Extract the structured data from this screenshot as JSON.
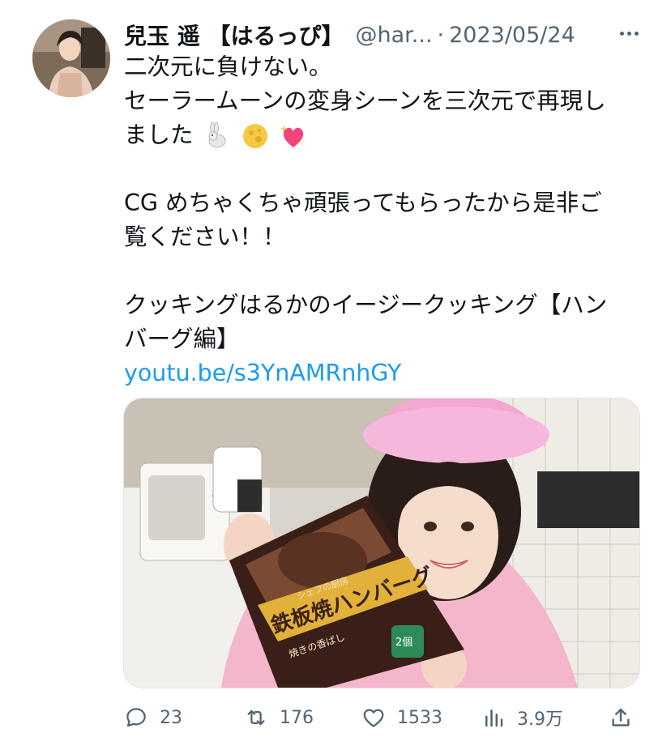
{
  "tweet": {
    "author_name": "兒玉 遥 【はるっぴ】",
    "handle": "@har...",
    "separator": "·",
    "date": "2023/05/24",
    "text_lines": [
      "二次元に負けない。",
      "セーラームーンの変身シーンを三次元で再現し",
      "ました",
      "",
      "CG めちゃくちゃ頑張ってもらったから是非ご",
      "覧ください！！",
      "",
      "クッキングはるかのイージークッキング【ハン",
      "バーグ編】"
    ],
    "link": "youtu.be/s3YnAMRnhGY",
    "emojis": [
      "rabbit-icon",
      "full-moon-icon",
      "sparkling-heart-icon"
    ]
  },
  "media": {
    "package_title": "鉄板焼ハンバーグ",
    "package_subtitle": "シェフの厨房",
    "package_tagline": "焼きの香ばし",
    "package_count": "2個"
  },
  "actions": {
    "replies": "23",
    "retweets": "176",
    "likes": "1533",
    "views": "3.9万"
  },
  "colors": {
    "text": "#0f1419",
    "secondary": "#536471",
    "link": "#1d9bf0"
  }
}
